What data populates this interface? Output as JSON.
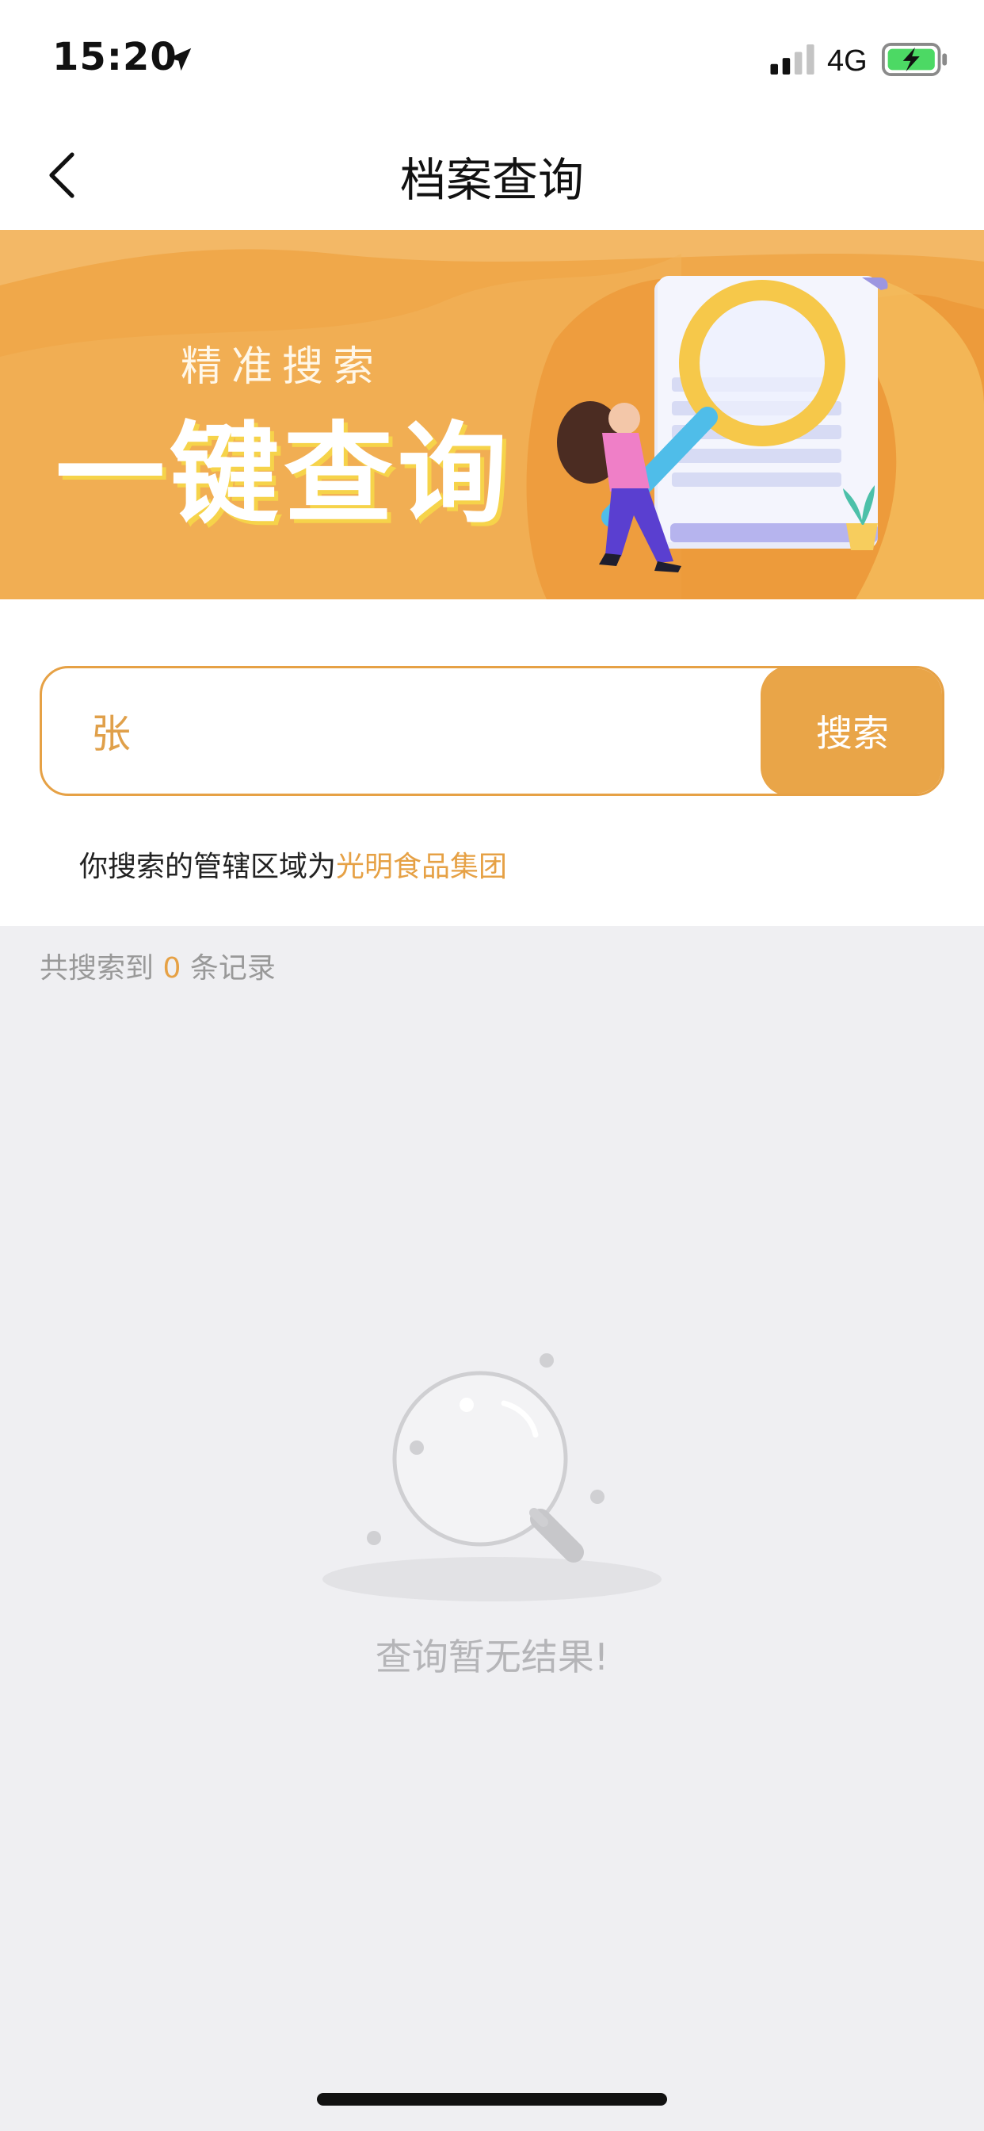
{
  "status_bar": {
    "time": "15:20",
    "network": "4G",
    "icons": [
      "location-arrow-icon",
      "signal-icon",
      "battery-charging-icon"
    ]
  },
  "nav": {
    "title": "档案查询",
    "back_icon": "chevron-left-icon"
  },
  "banner": {
    "subtitle": "精准搜索",
    "title": "一键查询"
  },
  "search": {
    "value": "张",
    "button_label": "搜索"
  },
  "region": {
    "prefix": "你搜索的管辖区域为",
    "name": "光明食品集团"
  },
  "results": {
    "prefix": "共搜索到",
    "count": "0",
    "suffix": "条记录",
    "empty_message": "查询暂无结果!"
  },
  "colors": {
    "accent": "#e9a548",
    "banner_bg": "#f0a84a",
    "page_bg": "#efeff2"
  }
}
